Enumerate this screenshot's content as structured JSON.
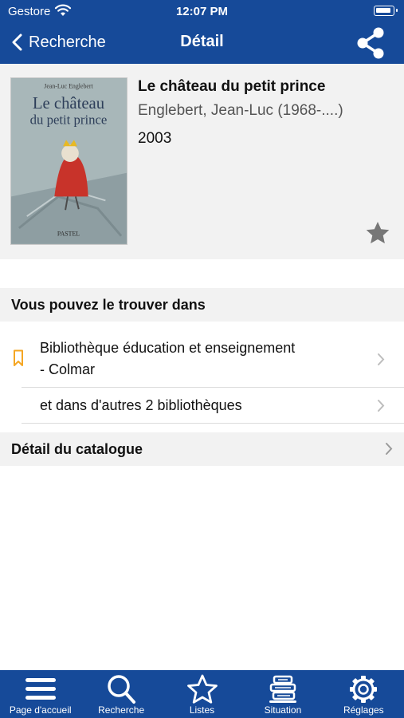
{
  "status_bar": {
    "carrier": "Gestore",
    "time": "12:07 PM"
  },
  "nav": {
    "back_label": "Recherche",
    "title": "Détail"
  },
  "book": {
    "title": "Le château du petit prince",
    "author": "Englebert, Jean-Luc (1968-....)",
    "year": "2003",
    "cover": {
      "author": "Jean-Luc Englebert",
      "title_line1": "Le château",
      "title_line2": "du petit prince",
      "publisher": "PASTEL"
    }
  },
  "locate": {
    "heading": "Vous pouvez le trouver dans",
    "library_line1": "Bibliothèque éducation et enseignement",
    "library_line2": "- Colmar",
    "others": "et dans d'autres 2 bibliothèques"
  },
  "catalog": {
    "label": "Détail du catalogue"
  },
  "tabs": [
    {
      "label": "Page d'accueil",
      "icon": "menu-icon"
    },
    {
      "label": "Recherche",
      "icon": "search-icon"
    },
    {
      "label": "Listes",
      "icon": "star-outline-icon"
    },
    {
      "label": "Situation",
      "icon": "book-stack-icon"
    },
    {
      "label": "Réglages",
      "icon": "gear-icon"
    }
  ],
  "colors": {
    "primary": "#164a99",
    "section_bg": "#f2f2f2",
    "bookmark": "#f5a623",
    "star": "#777777"
  }
}
